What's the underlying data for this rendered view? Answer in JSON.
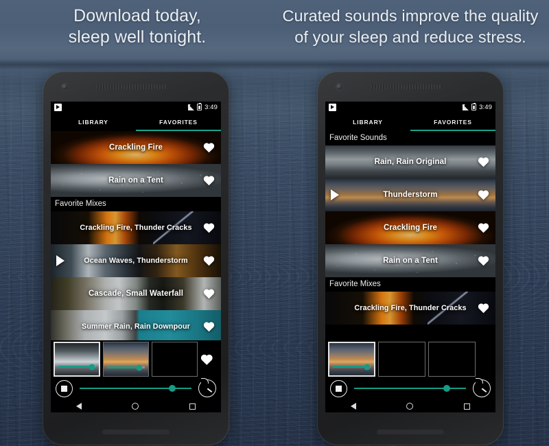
{
  "headlines": {
    "left": "Download today,\nsleep well tonight.",
    "right": "Curated sounds improve the quality\nof your sleep and reduce stress."
  },
  "colors": {
    "accent_teal": "#189b86",
    "screen_black": "#000000",
    "text_white": "#ffffff",
    "background_water": "#3c4f68"
  },
  "phones": [
    {
      "name": "left-phone",
      "status_bar": {
        "app_icon": "app-notification-icon",
        "signal_icon": "signal-icon",
        "battery_icon": "battery-icon",
        "time": "3:49"
      },
      "tabs": [
        {
          "label": "LIBRARY",
          "active": false
        },
        {
          "label": "FAVORITES",
          "active": true
        }
      ],
      "list": [
        {
          "type": "sound",
          "title": "Crackling Fire",
          "partial": true,
          "playing": false,
          "favorite": true,
          "art": "fire"
        },
        {
          "type": "sound",
          "title": "Rain on a Tent",
          "playing": false,
          "favorite": true,
          "art": "rain-tent"
        },
        {
          "type": "header",
          "title": "Favorite Mixes"
        },
        {
          "type": "mix",
          "title": "Crackling Fire, Thunder Cracks",
          "playing": false,
          "favorite": true,
          "art": "fire-storm"
        },
        {
          "type": "mix",
          "title": "Ocean Waves, Thunderstorm",
          "playing": true,
          "favorite": true,
          "art": "ocean-storm"
        },
        {
          "type": "mix",
          "title": "Cascade, Small Waterfall",
          "playing": false,
          "favorite": true,
          "art": "cascade"
        },
        {
          "type": "mix",
          "title": "Summer Rain, Rain Downpour",
          "playing": false,
          "favorite": true,
          "art": "summer-rain"
        }
      ],
      "mixer": {
        "slots": [
          {
            "art": "waves-grey",
            "active": true,
            "volume": 92,
            "empty": false
          },
          {
            "art": "sunset-clouds",
            "active": false,
            "volume": 86,
            "empty": false
          },
          {
            "art": "dark",
            "active": false,
            "volume": 0,
            "empty": true
          }
        ],
        "heart_icon": "heart-icon"
      },
      "transport": {
        "stop_icon": "stop-icon",
        "timer_icon": "sleep-timer-icon",
        "progress": 83
      },
      "navbar": {
        "back": "back-icon",
        "home": "home-icon",
        "recents": "recents-icon"
      }
    },
    {
      "name": "right-phone",
      "status_bar": {
        "app_icon": "app-notification-icon",
        "signal_icon": "signal-icon",
        "battery_icon": "battery-icon",
        "time": "3:49"
      },
      "tabs": [
        {
          "label": "LIBRARY",
          "active": false
        },
        {
          "label": "FAVORITES",
          "active": true
        }
      ],
      "list": [
        {
          "type": "header",
          "title": "Favorite Sounds"
        },
        {
          "type": "sound",
          "title": "Rain, Rain Original",
          "playing": false,
          "favorite": true,
          "art": "storm-sky"
        },
        {
          "type": "sound",
          "title": "Thunderstorm",
          "playing": true,
          "favorite": true,
          "art": "sunset-clouds"
        },
        {
          "type": "sound",
          "title": "Crackling Fire",
          "playing": false,
          "favorite": true,
          "art": "fire"
        },
        {
          "type": "sound",
          "title": "Rain on a Tent",
          "playing": false,
          "favorite": true,
          "art": "rain-tent"
        },
        {
          "type": "header",
          "title": "Favorite Mixes"
        },
        {
          "type": "mix",
          "title": "Crackling Fire, Thunder Cracks",
          "playing": false,
          "favorite": true,
          "art": "fire-storm"
        }
      ],
      "mixer": {
        "slots": [
          {
            "art": "sunset-clouds",
            "active": true,
            "volume": 90,
            "empty": false
          },
          {
            "art": "dark",
            "active": false,
            "volume": 0,
            "empty": true
          },
          {
            "art": "dark",
            "active": false,
            "volume": 0,
            "empty": true
          }
        ],
        "heart_icon": null
      },
      "transport": {
        "stop_icon": "stop-icon",
        "timer_icon": "sleep-timer-icon",
        "progress": 83
      },
      "navbar": {
        "back": "back-icon",
        "home": "home-icon",
        "recents": "recents-icon"
      }
    }
  ]
}
